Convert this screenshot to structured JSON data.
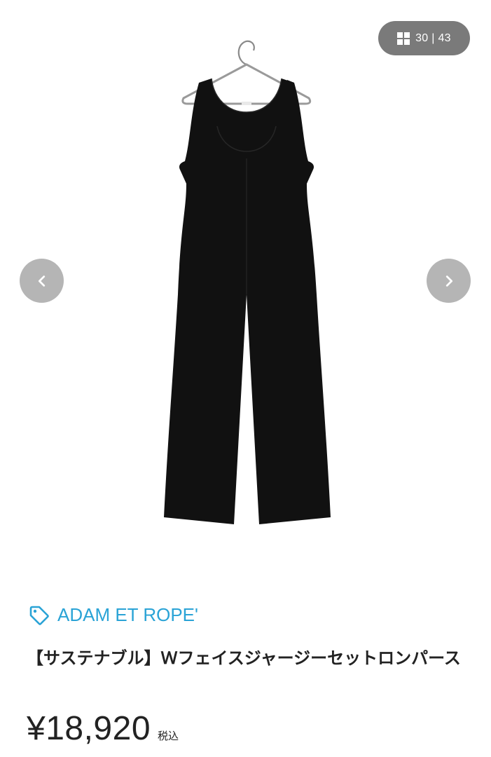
{
  "gallery": {
    "counter_current": "30",
    "counter_separator": "|",
    "counter_total": "43",
    "image_alt": "black sleeveless jumpsuit on a hanger",
    "grid_icon": "grid-icon",
    "prev_icon": "chevron-left-icon",
    "next_icon": "chevron-right-icon"
  },
  "product": {
    "brand": "ADAM ET ROPE'",
    "brand_icon": "tag-icon",
    "title": "【サステナブル】Ｗフェイスジャージーセットロンパース",
    "price": "¥18,920",
    "tax_label": "税込"
  },
  "colors": {
    "brand": "#2aa3d6",
    "text": "#222222",
    "pill_bg": "#7a7a7a",
    "nav_btn_bg": "#b4b4b4",
    "garment": "#111111"
  }
}
